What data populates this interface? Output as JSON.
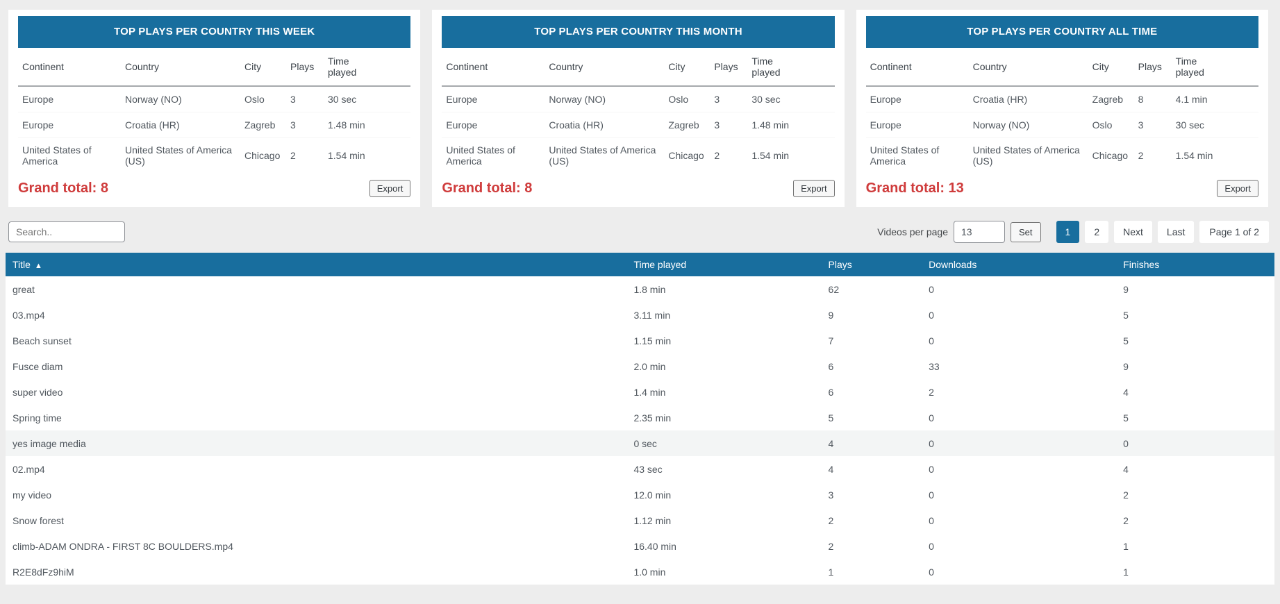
{
  "colors": {
    "accent": "#186e9e",
    "grand_total_red": "#cf3b3b"
  },
  "cards": [
    {
      "title": "TOP PLAYS PER COUNTRY THIS WEEK",
      "columns": [
        "Continent",
        "Country",
        "City",
        "Plays",
        "Time played"
      ],
      "rows": [
        [
          "Europe",
          "Norway (NO)",
          "Oslo",
          "3",
          "30 sec"
        ],
        [
          "Europe",
          "Croatia (HR)",
          "Zagreb",
          "3",
          "1.48 min"
        ],
        [
          "United States of America",
          "United States of America (US)",
          "Chicago",
          "2",
          "1.54 min"
        ]
      ],
      "grand_total": "Grand total: 8",
      "export_label": "Export"
    },
    {
      "title": "TOP PLAYS PER COUNTRY THIS MONTH",
      "columns": [
        "Continent",
        "Country",
        "City",
        "Plays",
        "Time played"
      ],
      "rows": [
        [
          "Europe",
          "Norway (NO)",
          "Oslo",
          "3",
          "30 sec"
        ],
        [
          "Europe",
          "Croatia (HR)",
          "Zagreb",
          "3",
          "1.48 min"
        ],
        [
          "United States of America",
          "United States of America (US)",
          "Chicago",
          "2",
          "1.54 min"
        ]
      ],
      "grand_total": "Grand total: 8",
      "export_label": "Export"
    },
    {
      "title": "TOP PLAYS PER COUNTRY ALL TIME",
      "columns": [
        "Continent",
        "Country",
        "City",
        "Plays",
        "Time played"
      ],
      "rows": [
        [
          "Europe",
          "Croatia (HR)",
          "Zagreb",
          "8",
          "4.1 min"
        ],
        [
          "Europe",
          "Norway (NO)",
          "Oslo",
          "3",
          "30 sec"
        ],
        [
          "United States of America",
          "United States of America (US)",
          "Chicago",
          "2",
          "1.54 min"
        ]
      ],
      "grand_total": "Grand total: 13",
      "export_label": "Export"
    }
  ],
  "toolbar": {
    "search_placeholder": "Search..",
    "per_page_label": "Videos per page",
    "per_page_value": "13",
    "set_label": "Set"
  },
  "pagination": {
    "pages": [
      "1",
      "2"
    ],
    "active_page": "1",
    "next_label": "Next",
    "last_label": "Last",
    "status": "Page 1 of 2"
  },
  "main_table": {
    "columns": [
      "Title",
      "Time played",
      "Plays",
      "Downloads",
      "Finishes"
    ],
    "sort_column": "Title",
    "sort_arrow": "▲",
    "highlighted_row_index": 6,
    "rows": [
      [
        "great",
        "1.8 min",
        "62",
        "0",
        "9"
      ],
      [
        "03.mp4",
        "3.11 min",
        "9",
        "0",
        "5"
      ],
      [
        "Beach sunset",
        "1.15 min",
        "7",
        "0",
        "5"
      ],
      [
        "Fusce diam",
        "2.0 min",
        "6",
        "33",
        "9"
      ],
      [
        "super video",
        "1.4 min",
        "6",
        "2",
        "4"
      ],
      [
        "Spring time",
        "2.35 min",
        "5",
        "0",
        "5"
      ],
      [
        "yes image media",
        "0 sec",
        "4",
        "0",
        "0"
      ],
      [
        "02.mp4",
        "43 sec",
        "4",
        "0",
        "4"
      ],
      [
        "my video",
        "12.0 min",
        "3",
        "0",
        "2"
      ],
      [
        "Snow forest",
        "1.12 min",
        "2",
        "0",
        "2"
      ],
      [
        "climb-ADAM ONDRA - FIRST 8C BOULDERS.mp4",
        "16.40 min",
        "2",
        "0",
        "1"
      ],
      [
        "R2E8dFz9hiM",
        "1.0 min",
        "1",
        "0",
        "1"
      ]
    ]
  }
}
